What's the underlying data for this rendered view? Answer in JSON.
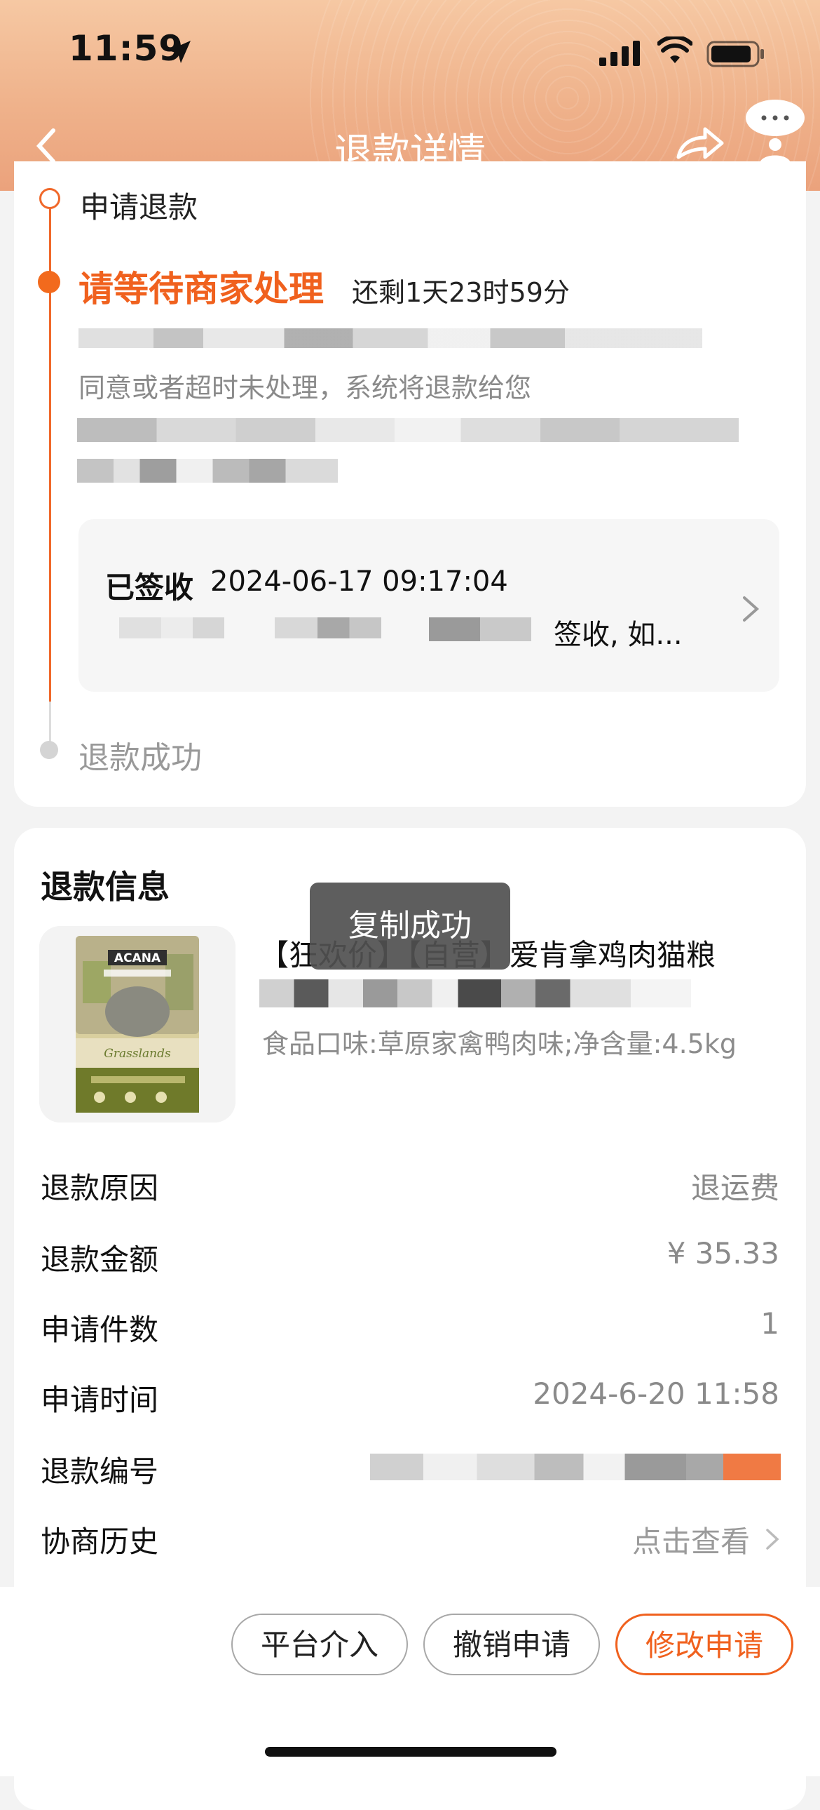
{
  "status_bar": {
    "time": "11:59"
  },
  "nav": {
    "title": "退款详情"
  },
  "progress": {
    "step1_label": "申请退款",
    "step2_title": "请等待商家处理",
    "step2_remaining": "还剩1天23时59分",
    "step2_desc": "同意或者超时未处理，系统将退款给您",
    "tracking": {
      "status": "已签收",
      "time": "2024-06-17 09:17:04",
      "text": "签收, 如..."
    },
    "step3_label": "退款成功"
  },
  "refund_info": {
    "title": "退款信息",
    "product": {
      "name": "【狂欢价】【自营】爱肯拿鸡肉猫粮",
      "spec": "食品口味:草原家禽鸭肉味;净含量:4.5kg",
      "image_brand": "ACANA",
      "image_line": "Grasslands"
    },
    "rows": [
      {
        "label": "退款原因",
        "value": "退运费"
      },
      {
        "label": "退款金额",
        "value": "¥ 35.33"
      },
      {
        "label": "申请件数",
        "value": "1"
      },
      {
        "label": "申请时间",
        "value": "2024-6-20 11:58"
      },
      {
        "label": "退款编号",
        "value": ""
      },
      {
        "label": "协商历史",
        "value": "点击查看"
      }
    ]
  },
  "toast": {
    "text": "复制成功"
  },
  "actions": {
    "platform": "平台介入",
    "cancel": "撤销申请",
    "modify": "修改申请"
  },
  "colors": {
    "accent": "#f0611e",
    "header": "#efb28b"
  }
}
